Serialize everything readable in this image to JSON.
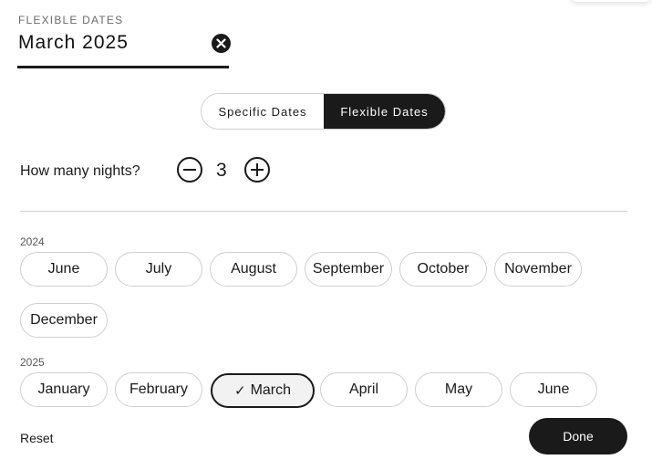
{
  "field": {
    "label": "FLEXIBLE DATES",
    "value": "March 2025"
  },
  "toggle": {
    "specific": "Specific Dates",
    "flexible": "Flexible Dates",
    "selected": "Flexible Dates"
  },
  "nights": {
    "label": "How many nights?",
    "value": "3"
  },
  "years": [
    {
      "year": "2024",
      "months": [
        "June",
        "July",
        "August",
        "September",
        "October",
        "November",
        "December"
      ]
    },
    {
      "year": "2025",
      "months": [
        "January",
        "February",
        "March",
        "April",
        "May",
        "June"
      ]
    }
  ],
  "selected_month": "March 2025",
  "actions": {
    "reset": "Reset",
    "done": "Done"
  },
  "icons": {
    "clear": "close-circle-icon",
    "minus": "minus-circle-icon",
    "plus": "plus-circle-icon",
    "check": "check-icon"
  },
  "colors": {
    "primary": "#1a1a1a",
    "border": "#cfcfcf",
    "selected_bg": "#f2f2f2"
  }
}
